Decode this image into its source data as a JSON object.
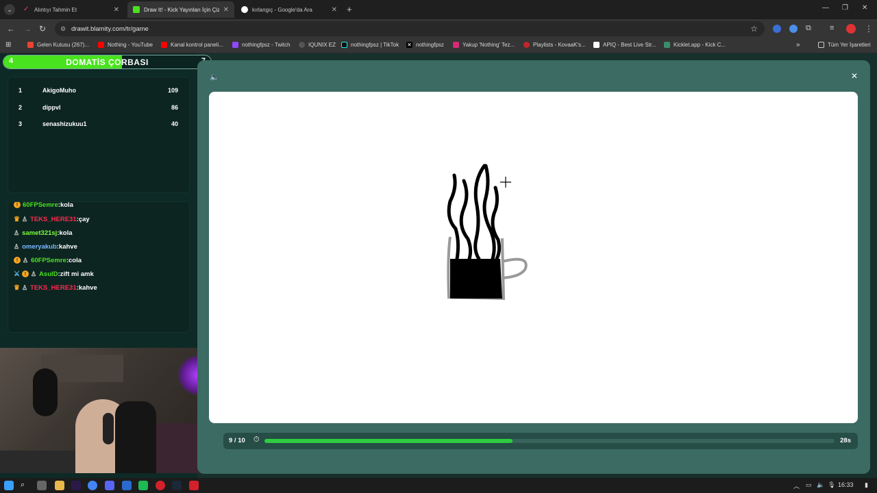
{
  "browser": {
    "tabs": [
      {
        "title": "Alıntıyı Tahmin Et",
        "active": false
      },
      {
        "title": "Draw It! - Kick Yayınları İçin Çizi",
        "active": true
      },
      {
        "title": "kırlangıç - Google'da Ara",
        "active": false
      }
    ],
    "url": "drawit.blamity.com/tr/game",
    "bookmarks": [
      "Gelen Kutusu (267)...",
      "Nothing - YouTube",
      "Kanal kontrol paneli...",
      "nothingfpsz - Twitch",
      "IQUNIX EZ",
      "nothingfpsz | TikTok",
      "nothingfpsz",
      "Yakup 'Nothing' Tez...",
      "Playlists - KovaaK's...",
      "APIQ - Best Live Str...",
      "Kicklet.app - Kick C..."
    ],
    "all_bookmarks": "Tüm Yer İşaretleri"
  },
  "word_bar": {
    "left_count": "4",
    "word": "DOMATİS ÇORBASI",
    "right_count": "7",
    "progress": 0.57
  },
  "leaderboard": [
    {
      "rank": "1",
      "name": "AkigoMuho",
      "score": "109"
    },
    {
      "rank": "2",
      "name": "dippvl",
      "score": "86"
    },
    {
      "rank": "3",
      "name": "senashizukuu1",
      "score": "40"
    }
  ],
  "chat": [
    {
      "user": "60FPSemre",
      "text": "kola",
      "color": "#49e21f",
      "badges": [
        "gold"
      ]
    },
    {
      "user": "TEKS_HERE31",
      "text": "çay",
      "color": "#ff2a4f",
      "badges": [
        "crown",
        "pawn"
      ]
    },
    {
      "user": "samet321sj",
      "text": "kola",
      "color": "#7cff3a",
      "badges": [
        "pawn"
      ]
    },
    {
      "user": "omeryakub",
      "text": "kahve",
      "color": "#7ab8ff",
      "badges": [
        "pawn"
      ]
    },
    {
      "user": "60FPSemre",
      "text": "cola",
      "color": "#49e21f",
      "badges": [
        "gold",
        "pawn"
      ]
    },
    {
      "user": "AsulD",
      "text": "zift mi amk",
      "color": "#49e21f",
      "badges": [
        "sword",
        "gold",
        "pawn"
      ]
    },
    {
      "user": "TEKS_HERE31",
      "text": "kahve",
      "color": "#ff2a4f",
      "badges": [
        "crown",
        "pawn"
      ]
    }
  ],
  "game": {
    "round": "9 / 10",
    "time_left": "28s",
    "time_progress": 0.435
  },
  "taskbar": {
    "time": "16:33"
  },
  "colors": {
    "accent_green": "#49e21f",
    "panel_bg": "#0e2a26",
    "frame_bg": "#3b6b63"
  }
}
